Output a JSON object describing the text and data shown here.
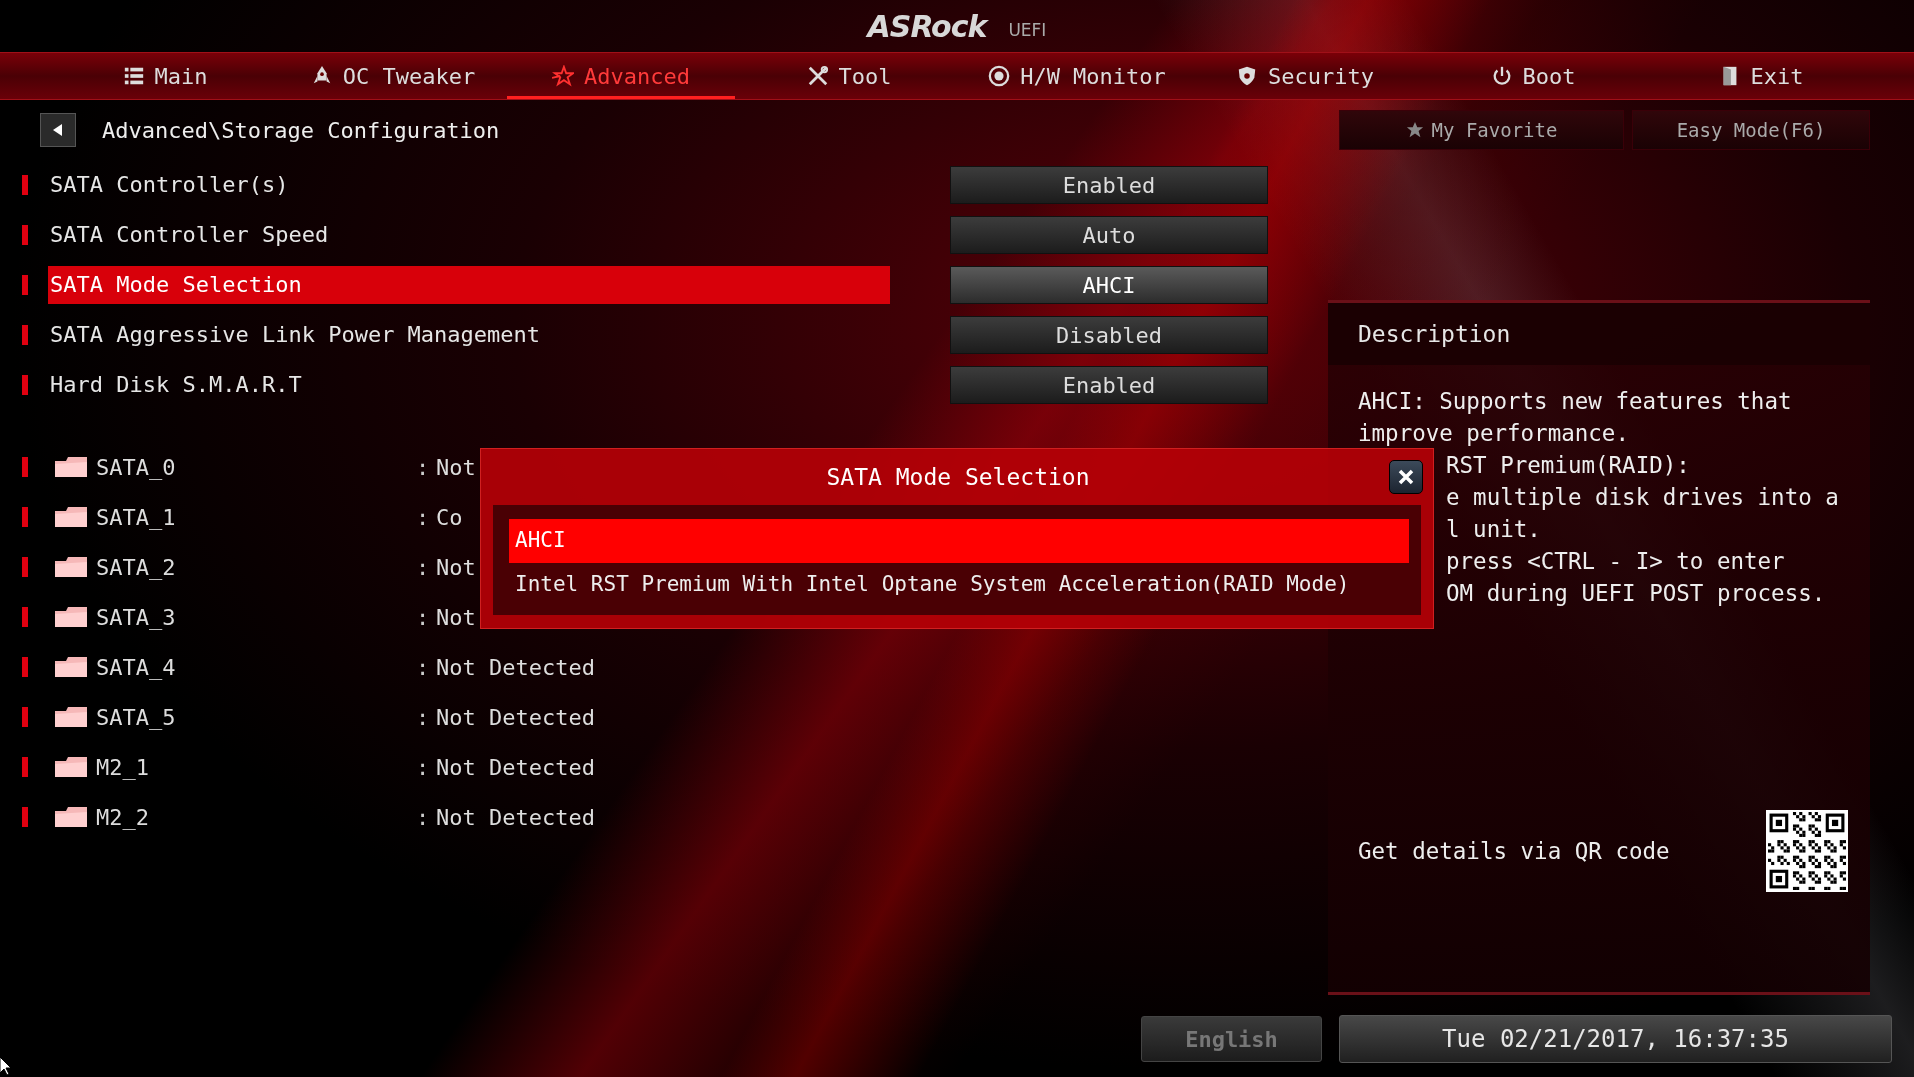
{
  "logo": {
    "brand": "ASRock",
    "suffix": "UEFI"
  },
  "tabs": [
    {
      "label": "Main",
      "selected": false
    },
    {
      "label": "OC Tweaker",
      "selected": false
    },
    {
      "label": "Advanced",
      "selected": true
    },
    {
      "label": "Tool",
      "selected": false
    },
    {
      "label": "H/W Monitor",
      "selected": false
    },
    {
      "label": "Security",
      "selected": false
    },
    {
      "label": "Boot",
      "selected": false
    },
    {
      "label": "Exit",
      "selected": false
    }
  ],
  "breadcrumb": "Advanced\\Storage Configuration",
  "top_buttons": {
    "favorite": "My Favorite",
    "easy_mode": "Easy Mode(F6)"
  },
  "settings": [
    {
      "label": "SATA Controller(s)",
      "value": "Enabled",
      "selected": false
    },
    {
      "label": "SATA Controller Speed",
      "value": "Auto",
      "selected": false
    },
    {
      "label": "SATA Mode Selection",
      "value": "AHCI",
      "selected": true
    },
    {
      "label": "SATA Aggressive Link Power Management",
      "value": "Disabled",
      "selected": false
    },
    {
      "label": "Hard Disk S.M.A.R.T",
      "value": "Enabled",
      "selected": false
    }
  ],
  "devices": [
    {
      "name": "SATA_0",
      "separator": ":",
      "value": "Not"
    },
    {
      "name": "SATA_1",
      "separator": ":",
      "value": "Co"
    },
    {
      "name": "SATA_2",
      "separator": ":",
      "value": "Not"
    },
    {
      "name": "SATA_3",
      "separator": ":",
      "value": "Not"
    },
    {
      "name": "SATA_4",
      "separator": ":",
      "value": "Not Detected"
    },
    {
      "name": "SATA_5",
      "separator": ":",
      "value": "Not Detected"
    },
    {
      "name": "M2_1",
      "separator": ":",
      "value": "Not Detected"
    },
    {
      "name": "M2_2",
      "separator": ":",
      "value": "Not Detected"
    }
  ],
  "popup": {
    "title": "SATA Mode Selection",
    "options": [
      {
        "label": "AHCI",
        "selected": true
      },
      {
        "label": "Intel RST Premium With Intel Optane System Acceleration(RAID Mode)",
        "selected": false
      }
    ]
  },
  "description": {
    "title": "Description",
    "lines": [
      {
        "text": "AHCI: Supports new features that",
        "kind": "full"
      },
      {
        "text": "improve performance.",
        "kind": "full"
      },
      {
        "text": "RST Premium(RAID):",
        "kind": "partial"
      },
      {
        "text": "e multiple disk drives into a",
        "kind": "partial"
      },
      {
        "text": "l unit.",
        "kind": "partial"
      },
      {
        "text": "press <CTRL - I> to enter",
        "kind": "partial"
      },
      {
        "text": "OM during UEFI POST process.",
        "kind": "partial"
      }
    ],
    "qr_caption": "Get details via QR code"
  },
  "footer": {
    "language": "English",
    "datetime": "Tue 02/21/2017, 16:37:35"
  }
}
